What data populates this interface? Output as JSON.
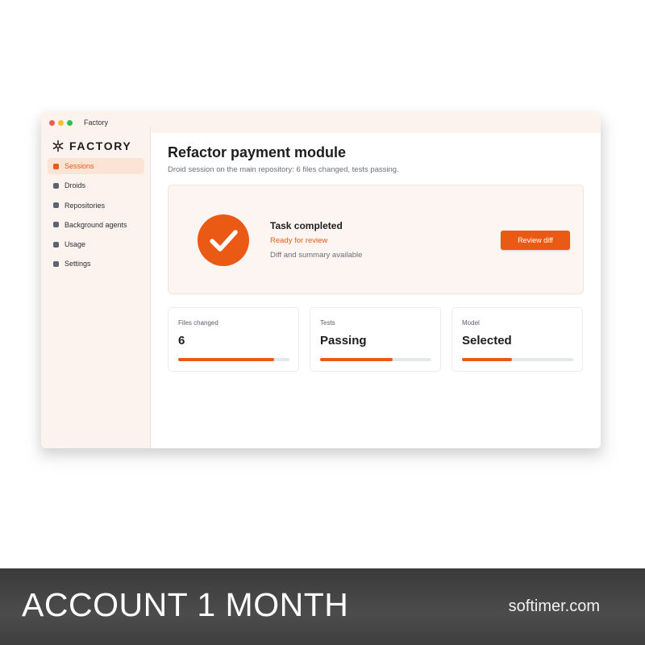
{
  "window": {
    "title": "Factory",
    "traffic_lights": [
      "#ef5b4f",
      "#f5bf2f",
      "#2fc046"
    ]
  },
  "sidebar": {
    "logo_text": "FACTORY",
    "logo_icon": "snowflake-asterisk-icon",
    "items": [
      {
        "label": "Sessions",
        "active": true
      },
      {
        "label": "Droids",
        "active": false
      },
      {
        "label": "Repositories",
        "active": false
      },
      {
        "label": "Background agents",
        "active": false
      },
      {
        "label": "Usage",
        "active": false
      },
      {
        "label": "Settings",
        "active": false
      }
    ]
  },
  "main": {
    "title": "Refactor payment module",
    "subtitle": "Droid session on the main repository: 6 files changed, tests passing.",
    "hero": {
      "icon": "checkmark-circle-icon",
      "title": "Task completed",
      "status": "Ready for review",
      "note": "Diff and summary available",
      "button_label": "Review diff"
    },
    "stats": [
      {
        "label": "Files changed",
        "value": "6",
        "progress": 0.86
      },
      {
        "label": "Tests",
        "value": "Passing",
        "progress": 0.65
      },
      {
        "label": "Model",
        "value": "Selected",
        "progress": 0.45
      }
    ]
  },
  "banner": {
    "title": "ACCOUNT 1 MONTH",
    "site": "softimer.com"
  },
  "colors": {
    "accent": "#ea5a14",
    "sidebar_bg": "#fdf3ee",
    "hero_bg": "#fdf5f1",
    "banner_bg": "#444444"
  }
}
